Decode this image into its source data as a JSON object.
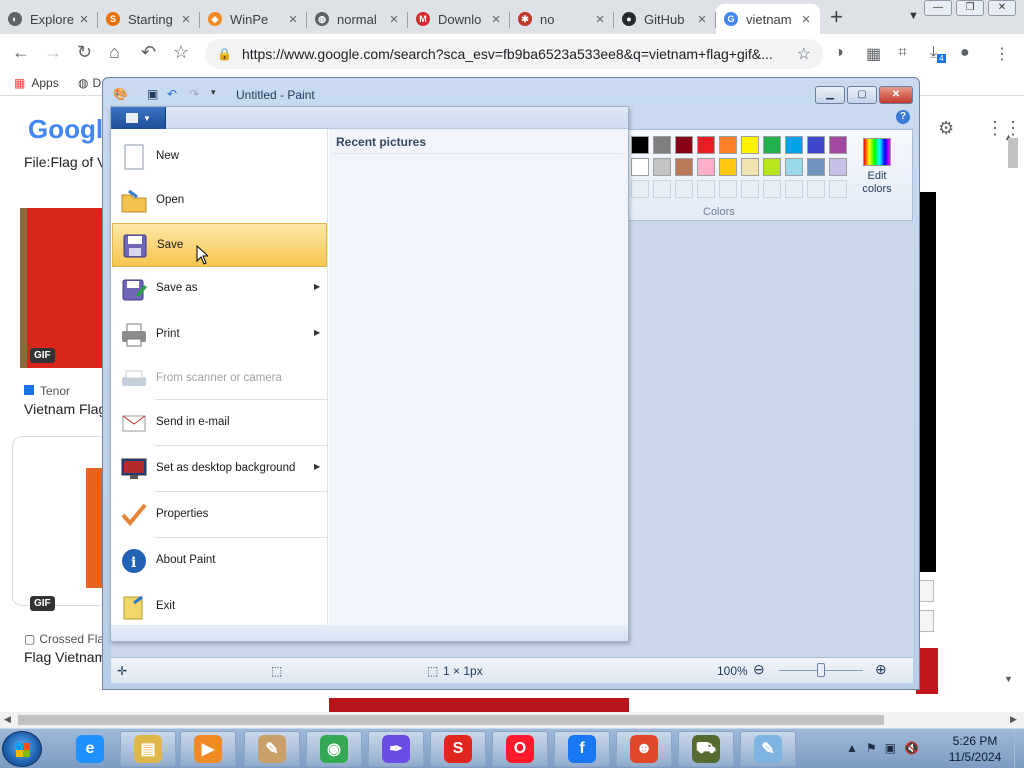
{
  "browser": {
    "tabs": [
      {
        "label": "Explore",
        "icon": "chrome-icon",
        "color": "#5f6368",
        "glyph": "◐"
      },
      {
        "label": "Starting",
        "icon": "blogger-icon",
        "color": "#e8710a",
        "glyph": "S"
      },
      {
        "label": "WinPe",
        "icon": "diamond-icon",
        "color": "#f08a24",
        "glyph": "◆"
      },
      {
        "label": "normal",
        "icon": "globe-icon",
        "color": "#5f6368",
        "glyph": "◍"
      },
      {
        "label": "Downlo",
        "icon": "mega-icon",
        "color": "#d9272e",
        "glyph": "M"
      },
      {
        "label": "no",
        "icon": "ladybug-icon",
        "color": "#c0392b",
        "glyph": "✱"
      },
      {
        "label": "GitHub",
        "icon": "github-icon",
        "color": "#24292e",
        "glyph": "●"
      },
      {
        "label": "vietnam",
        "icon": "google-icon",
        "color": "#4285f4",
        "glyph": "G"
      }
    ],
    "new_tab": "+",
    "url": "https://www.google.com/search?sca_esv=fb9ba6523a533ee8&q=vietnam+flag+gif&...",
    "bookmarks": {
      "apps": "Apps",
      "second": "D"
    },
    "download_badge": "4"
  },
  "google": {
    "logo": "Googl",
    "file_title": "File:Flag of V",
    "result1": {
      "badge": "GIF",
      "source": "Tenor",
      "title": "Vietnam Flag"
    },
    "result2": {
      "badge": "GIF",
      "source": "Crossed Fla",
      "title": "Flag Vietnam"
    }
  },
  "paint": {
    "title": "Untitled - Paint",
    "help": "?",
    "colors_label": "Colors",
    "edit_colors": [
      "Edit",
      "colors"
    ],
    "palette_row1": [
      "#000000",
      "#7f7f7f",
      "#880015",
      "#ed1c24",
      "#ff7f27",
      "#fff200",
      "#22b14c",
      "#00a2e8",
      "#3f48cc",
      "#a349a4"
    ],
    "palette_row2": [
      "#ffffff",
      "#c3c3c3",
      "#b97a57",
      "#ffaec9",
      "#ffc90e",
      "#efe4b0",
      "#b5e61d",
      "#99d9ea",
      "#7092be",
      "#c8bfe7"
    ],
    "status_size": "1 × 1px",
    "zoom": "100%",
    "zoom_level": 1.0,
    "file_menu": {
      "recent_header": "Recent pictures",
      "items": [
        {
          "label": "New",
          "icon": "new-file-icon",
          "hl": false,
          "dis": false,
          "arrow": false
        },
        {
          "label": "Open",
          "icon": "open-folder-icon",
          "hl": false,
          "dis": false,
          "arrow": false
        },
        {
          "label": "Save",
          "icon": "save-disk-icon",
          "hl": true,
          "dis": false,
          "arrow": false
        },
        {
          "label": "Save as",
          "icon": "save-as-icon",
          "hl": false,
          "dis": false,
          "arrow": true
        },
        {
          "label": "Print",
          "icon": "printer-icon",
          "hl": false,
          "dis": false,
          "arrow": true
        },
        {
          "label": "From scanner or camera",
          "icon": "scanner-icon",
          "hl": false,
          "dis": true,
          "arrow": false
        },
        {
          "label": "Send in e-mail",
          "icon": "email-icon",
          "hl": false,
          "dis": false,
          "arrow": false
        },
        {
          "label": "Set as desktop background",
          "icon": "desktop-background-icon",
          "hl": false,
          "dis": false,
          "arrow": true
        },
        {
          "label": "Properties",
          "icon": "properties-check-icon",
          "hl": false,
          "dis": false,
          "arrow": false
        },
        {
          "label": "About Paint",
          "icon": "info-icon",
          "hl": false,
          "dis": false,
          "arrow": false
        },
        {
          "label": "Exit",
          "icon": "exit-icon",
          "hl": false,
          "dis": false,
          "arrow": false
        }
      ]
    }
  },
  "taskbar": {
    "apps": [
      {
        "name": "internet-explorer",
        "glyph": "e",
        "color": "#1e90ff"
      },
      {
        "name": "file-explorer",
        "glyph": "▤",
        "color": "#e0b84a"
      },
      {
        "name": "media-player",
        "glyph": "▶",
        "color": "#f08a24"
      },
      {
        "name": "paint-palette",
        "glyph": "✎",
        "color": "#c9a06a"
      },
      {
        "name": "chrome",
        "glyph": "◉",
        "color": "#34a853"
      },
      {
        "name": "pen-tool",
        "glyph": "✒",
        "color": "#6b4ce6"
      },
      {
        "name": "s-app",
        "glyph": "S",
        "color": "#e0261f"
      },
      {
        "name": "opera",
        "glyph": "O",
        "color": "#ff1b2d"
      },
      {
        "name": "facebook",
        "glyph": "f",
        "color": "#1877f2"
      },
      {
        "name": "cartoon",
        "glyph": "☻",
        "color": "#e0482a"
      },
      {
        "name": "car",
        "glyph": "⛟",
        "color": "#556b2f"
      },
      {
        "name": "paint-app",
        "glyph": "✎",
        "color": "#7fb3e0"
      }
    ],
    "time": "5:26 PM",
    "date": "11/5/2024"
  }
}
